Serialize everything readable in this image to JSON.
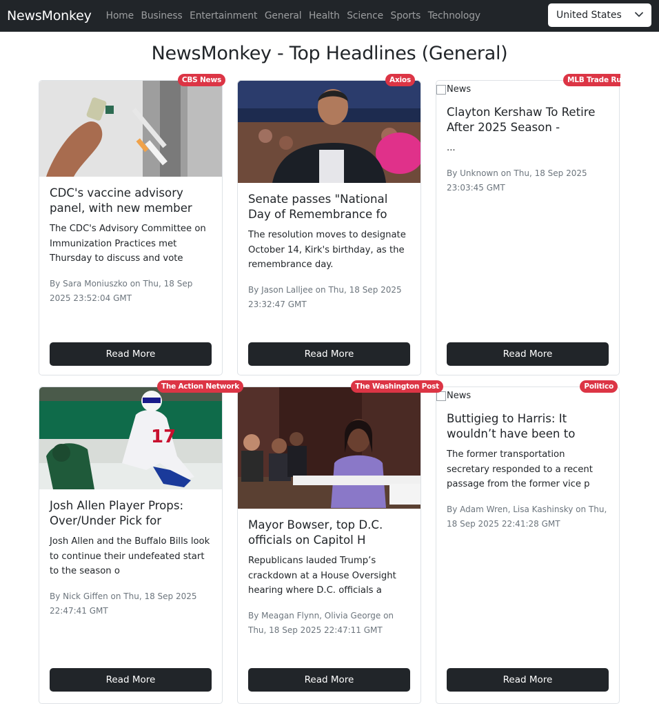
{
  "navbar": {
    "brand": "NewsMonkey",
    "links": [
      "Home",
      "Business",
      "Entertainment",
      "General",
      "Health",
      "Science",
      "Sports",
      "Technology"
    ],
    "country": "United States"
  },
  "page_title": "NewsMonkey - Top Headlines (General)",
  "colors": {
    "navbar": "#212529",
    "badge": "#dc3545",
    "button": "#212529"
  },
  "broken_image_alt": "News",
  "articles": [
    {
      "source": "CBS News",
      "title": "CDC's vaccine advisory panel, with new member",
      "description": "The CDC's Advisory Committee on Immunization Practices met Thursday to discuss and vote",
      "meta": "By Sara Moniuszko on Thu, 18 Sep 2025 23:52:04 GMT",
      "button": "Read More"
    },
    {
      "source": "Axios",
      "title": "Senate passes \"National Day of Remembrance fo",
      "description": "The resolution moves to designate October 14, Kirk's birthday, as the remembrance day.",
      "meta": "By Jason Lalljee on Thu, 18 Sep 2025 23:32:47 GMT",
      "button": "Read More"
    },
    {
      "source": "MLB Trade Rum",
      "title": "Clayton Kershaw To Retire After 2025 Season -",
      "description": "...",
      "meta": "By Unknown on Thu, 18 Sep 2025 23:03:45 GMT",
      "button": "Read More"
    },
    {
      "source": "The Action Network",
      "title": "Josh Allen Player Props: Over/Under Pick for",
      "description": "Josh Allen and the Buffalo Bills look to continue their undefeated start to the season o",
      "meta": "By Nick Giffen on Thu, 18 Sep 2025 22:47:41 GMT",
      "button": "Read More"
    },
    {
      "source": "The Washington Post",
      "title": "Mayor Bowser, top D.C. officials on Capitol H",
      "description": "Republicans lauded Trump’s crackdown at a House Oversight hearing where D.C. officials a",
      "meta": "By Meagan Flynn, Olivia George on Thu, 18 Sep 2025 22:47:11 GMT",
      "button": "Read More"
    },
    {
      "source": "Politico",
      "title": "Buttigieg to Harris: It wouldn’t have been to",
      "description": "The former transportation secretary responded to a recent passage from the former vice p",
      "meta": "By Adam Wren, Lisa Kashinsky on Thu, 18 Sep 2025 22:41:28 GMT",
      "button": "Read More"
    }
  ]
}
